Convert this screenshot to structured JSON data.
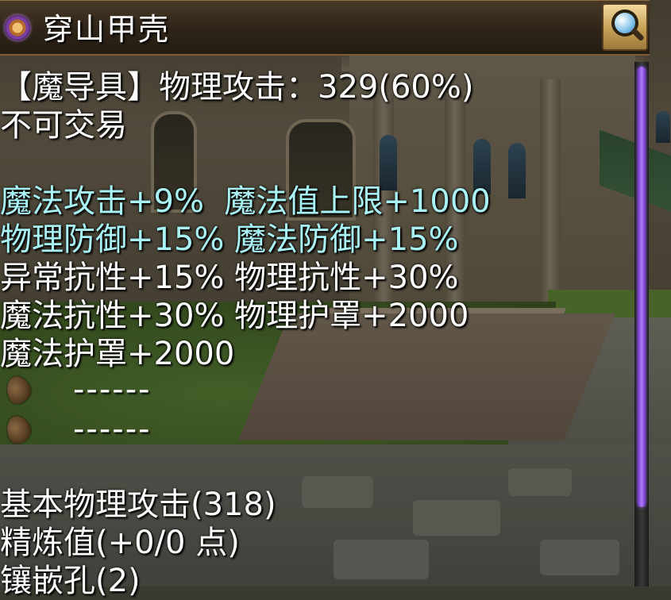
{
  "title": {
    "text": "穿山甲壳",
    "icon": "item-ring-icon"
  },
  "toolbar": {
    "search_icon": "magnifier-icon"
  },
  "item": {
    "header_line": "【魔导具】物理攻击：329(60%)",
    "trade_status": "不可交易",
    "bonus_lines": [
      {
        "text": "魔法攻击+9%  魔法值上限+1000",
        "color": "#a9f3f7"
      },
      {
        "text": "物理防御+15% 魔法防御+15%",
        "color": "#a9f3f7"
      },
      {
        "text": "异常抗性+15% 物理抗性+30%",
        "color": "#ffffff"
      },
      {
        "text": "魔法抗性+30% 物理护罩+2000",
        "color": "#ffffff"
      },
      {
        "text": "魔法护罩+2000",
        "color": "#ffffff"
      }
    ],
    "sockets": [
      {
        "icon": "empty-socket-gem-icon",
        "text": "------"
      },
      {
        "icon": "empty-socket-gem-icon",
        "text": "------"
      }
    ],
    "base_attack": "基本物理攻击(318)",
    "refine": "精炼值(+0/0 点)",
    "inlay_holes": "镶嵌孔(2)"
  },
  "colors": {
    "cyan": "#a9f3f7",
    "white": "#ffffff",
    "scroll_thumb": "#9c60ff"
  },
  "scrollbar": {
    "position_fraction": 0.0,
    "visible_fraction": 0.85
  }
}
